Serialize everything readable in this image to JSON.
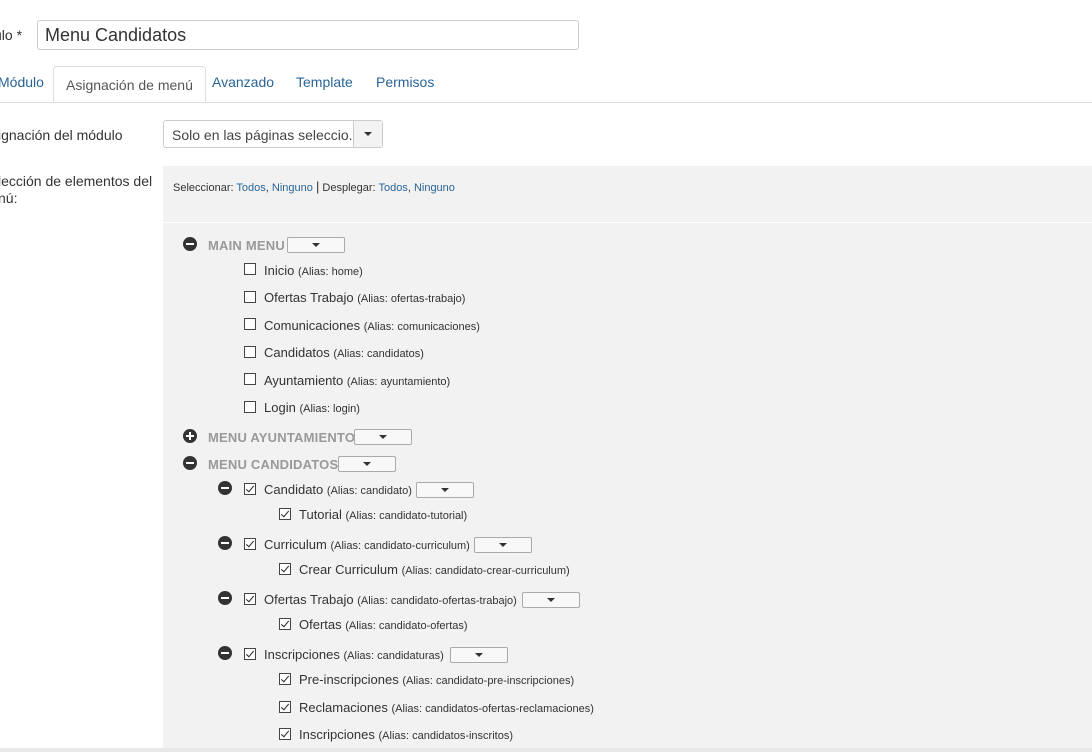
{
  "title_field": {
    "label": "ulo *",
    "value": "Menu Candidatos"
  },
  "tabs": [
    {
      "label": "Módulo",
      "active": false
    },
    {
      "label": "Asignación de menú",
      "active": true
    },
    {
      "label": "Avanzado",
      "active": false
    },
    {
      "label": "Template",
      "active": false
    },
    {
      "label": "Permisos",
      "active": false
    }
  ],
  "assignment": {
    "label": "ignación del módulo",
    "selected": "Solo en las páginas seleccio..."
  },
  "selection": {
    "label": "lección de elementos del\nnú:",
    "toolbar": {
      "select_label": "Seleccionar:",
      "all": "Todos",
      "comma": ",",
      "none": "Ninguno",
      "sep": "|",
      "expand_label": "Desplegar:",
      "expand_all": "Todos",
      "expand_none": "Ninguno"
    }
  },
  "menus": {
    "main": {
      "name": "MAIN MENU",
      "expanded": true,
      "items": [
        {
          "label": "Inicio",
          "alias": "(Alias: home)",
          "checked": false
        },
        {
          "label": "Ofertas Trabajo",
          "alias": "(Alias: ofertas-trabajo)",
          "checked": false
        },
        {
          "label": "Comunicaciones",
          "alias": "(Alias: comunicaciones)",
          "checked": false
        },
        {
          "label": "Candidatos",
          "alias": "(Alias: candidatos)",
          "checked": false
        },
        {
          "label": "Ayuntamiento",
          "alias": "(Alias: ayuntamiento)",
          "checked": false
        },
        {
          "label": "Login",
          "alias": "(Alias: login)",
          "checked": false
        }
      ]
    },
    "ayuntamiento": {
      "name": "MENU AYUNTAMIENTO",
      "expanded": false
    },
    "candidatos": {
      "name": "MENU CANDIDATOS",
      "expanded": true,
      "items": [
        {
          "label": "Candidato",
          "alias": "(Alias: candidato)",
          "checked": true,
          "children": [
            {
              "label": "Tutorial",
              "alias": "(Alias: candidato-tutorial)",
              "checked": true
            }
          ]
        },
        {
          "label": "Curriculum",
          "alias": "(Alias: candidato-curriculum)",
          "checked": true,
          "children": [
            {
              "label": "Crear Curriculum",
              "alias": "(Alias: candidato-crear-curriculum)",
              "checked": true
            }
          ]
        },
        {
          "label": "Ofertas Trabajo",
          "alias": "(Alias: candidato-ofertas-trabajo)",
          "checked": true,
          "children": [
            {
              "label": "Ofertas",
              "alias": "(Alias: candidato-ofertas)",
              "checked": true
            }
          ]
        },
        {
          "label": "Inscripciones",
          "alias": "(Alias: candidaturas)",
          "checked": true,
          "children": [
            {
              "label": "Pre-inscripciones",
              "alias": "(Alias: candidato-pre-inscripciones)",
              "checked": true
            },
            {
              "label": "Reclamaciones",
              "alias": "(Alias: candidatos-ofertas-reclamaciones)",
              "checked": true
            },
            {
              "label": "Inscripciones",
              "alias": "(Alias: candidatos-inscritos)",
              "checked": true
            }
          ]
        }
      ]
    }
  }
}
